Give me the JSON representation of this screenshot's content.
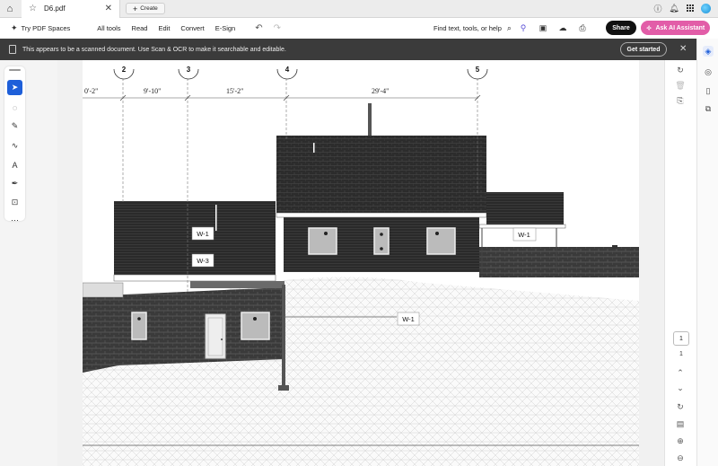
{
  "tabbar": {
    "doc_tab_label": "D6.pdf",
    "create_label": "Create"
  },
  "toolbar": {
    "spaces_label": "Try PDF Spaces",
    "nav": [
      "All tools",
      "Read",
      "Edit",
      "Convert",
      "E-Sign"
    ],
    "find_label": "Find text, tools, or help",
    "share_label": "Share",
    "ai_label": "Ask AI Assistant"
  },
  "banner": {
    "message": "This appears to be a scanned document. Use Scan & OCR to make it searchable and editable.",
    "cta_label": "Get started"
  },
  "drawing": {
    "grid_markers": [
      "2",
      "3",
      "4",
      "5"
    ],
    "dimensions": [
      "0'-2\"",
      "9'-10\"",
      "15'-2\"",
      "29'-4\""
    ],
    "tags": [
      "W-1",
      "W-3",
      "W-1",
      "W-1"
    ]
  },
  "pagenav": {
    "current_page": "1",
    "total_pages": "1"
  },
  "colors": {
    "accent": "#1e5fd9",
    "ai_button": "#e25da8",
    "banner_bg": "#3b3b3b"
  }
}
